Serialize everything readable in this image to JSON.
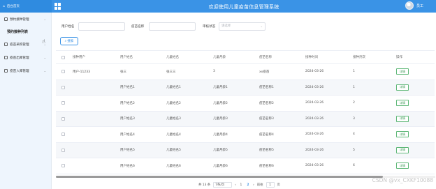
{
  "header": {
    "logo_text": "后台首页",
    "title": "欢迎使用儿童疫苗信息管理系统",
    "user_name": "员工"
  },
  "sidebar": {
    "items": [
      {
        "label": "预约接种管理",
        "icon": "folder-icon"
      },
      {
        "label": "预约接种列表",
        "is_sub": true
      },
      {
        "label": "疫苗采购管理",
        "icon": "folder-icon"
      },
      {
        "label": "疫苗出库管理",
        "icon": "folder-icon"
      },
      {
        "label": "疫苗入库管理",
        "icon": "folder-icon"
      }
    ]
  },
  "search": {
    "user_name_label": "用户姓名",
    "vaccine_name_label": "疫苗名称",
    "audit_status_label": "审核状态",
    "audit_status_placeholder": "请选择",
    "search_button": "搜索"
  },
  "table": {
    "columns": [
      "",
      "接种用户",
      "用户姓名",
      "儿童姓名",
      "儿童月龄",
      "疫苗名称",
      "接种时间",
      "接种剂次",
      "操作"
    ],
    "rows": [
      {
        "user": "用户-11233",
        "user_name": "张三",
        "child_name": "张三三",
        "age": "3",
        "vaccine": "xx疫苗",
        "date": "2024-03-26",
        "dose": "1",
        "action": "详情"
      },
      {
        "user": "",
        "user_name": "用户姓名1",
        "child_name": "儿童姓名1",
        "age": "儿童月龄1",
        "vaccine": "疫苗名称1",
        "date": "2024-03-26",
        "dose": "1",
        "action": "详情"
      },
      {
        "user": "",
        "user_name": "用户姓名2",
        "child_name": "儿童姓名2",
        "age": "儿童月龄2",
        "vaccine": "疫苗名称2",
        "date": "2024-03-26",
        "dose": "2",
        "action": "详情"
      },
      {
        "user": "",
        "user_name": "用户姓名3",
        "child_name": "儿童姓名3",
        "age": "儿童月龄3",
        "vaccine": "疫苗名称3",
        "date": "2024-03-26",
        "dose": "3",
        "action": "详情"
      },
      {
        "user": "",
        "user_name": "用户姓名4",
        "child_name": "儿童姓名4",
        "age": "儿童月龄4",
        "vaccine": "疫苗名称4",
        "date": "2024-03-26",
        "dose": "4",
        "action": "详情"
      },
      {
        "user": "",
        "user_name": "用户姓名5",
        "child_name": "儿童姓名5",
        "age": "儿童月龄5",
        "vaccine": "疫苗名称5",
        "date": "2024-03-26",
        "dose": "5",
        "action": "详情"
      },
      {
        "user": "",
        "user_name": "用户姓名6",
        "child_name": "儿童姓名6",
        "age": "儿童月龄6",
        "vaccine": "疫苗名称6",
        "date": "2024-03-26",
        "dose": "6",
        "action": "详情"
      }
    ]
  },
  "pagination": {
    "total": "共 13 条",
    "page_size": "7条/页",
    "pages": [
      "1",
      "2"
    ],
    "current": "2",
    "goto_label": "前往",
    "goto_value": "1",
    "page_suffix": "页"
  },
  "watermark": "CSDN @vx_CXKF10088",
  "colors": {
    "accent": "#3a93e6",
    "sidebar_bg": "#eef5fd",
    "detail_button": "#5fb878"
  }
}
